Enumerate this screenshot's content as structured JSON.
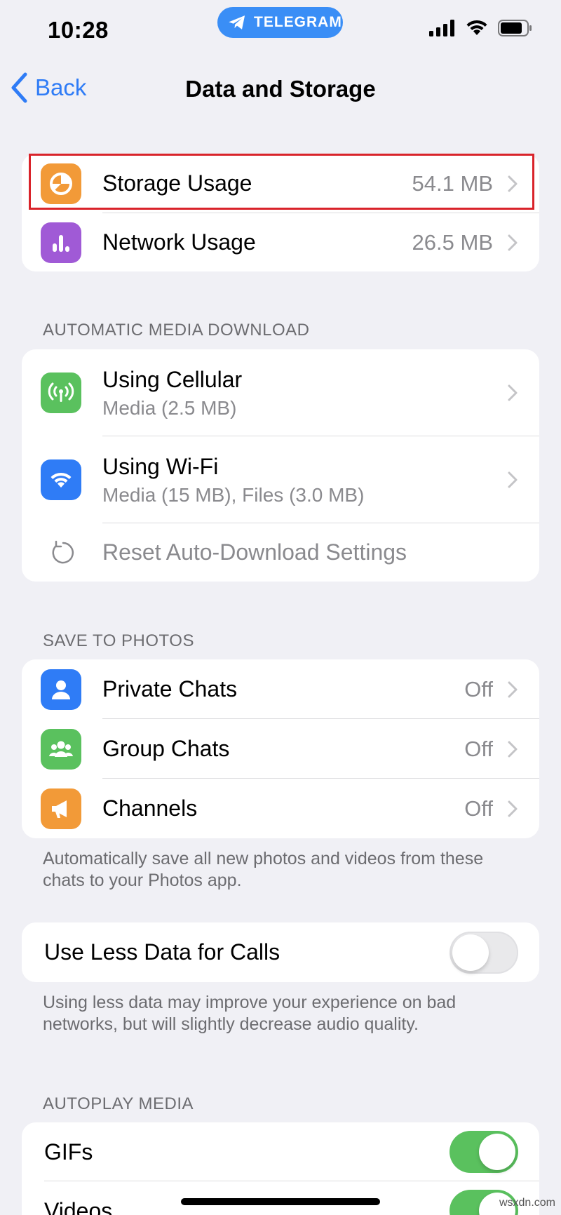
{
  "status_bar": {
    "time": "10:28",
    "pill_label": "TELEGRAM"
  },
  "nav": {
    "back_label": "Back",
    "title": "Data and Storage"
  },
  "usage": {
    "storage": {
      "label": "Storage Usage",
      "value": "54.1 MB",
      "icon": "pie-chart-icon",
      "color": "#f29a38"
    },
    "network": {
      "label": "Network Usage",
      "value": "26.5 MB",
      "icon": "bar-chart-icon",
      "color": "#a05ad6"
    }
  },
  "auto_download": {
    "header": "AUTOMATIC MEDIA DOWNLOAD",
    "cellular": {
      "label": "Using Cellular",
      "sub": "Media (2.5 MB)",
      "icon": "antenna-icon",
      "color": "#5ac15e"
    },
    "wifi": {
      "label": "Using Wi-Fi",
      "sub": "Media (15 MB), Files (3.0 MB)",
      "icon": "wifi-icon",
      "color": "#2f7cf6"
    },
    "reset": {
      "label": "Reset Auto-Download Settings",
      "icon": "reset-icon"
    }
  },
  "save_to_photos": {
    "header": "SAVE TO PHOTOS",
    "private": {
      "label": "Private Chats",
      "value": "Off",
      "icon": "person-icon",
      "color": "#2f7cf6"
    },
    "group": {
      "label": "Group Chats",
      "value": "Off",
      "icon": "group-icon",
      "color": "#5ac15e"
    },
    "channels": {
      "label": "Channels",
      "value": "Off",
      "icon": "megaphone-icon",
      "color": "#f29a38"
    },
    "footer": "Automatically save all new photos and videos from these chats to your Photos app."
  },
  "calls": {
    "label": "Use Less Data for Calls",
    "enabled": false,
    "footer": "Using less data may improve your experience on bad networks, but will slightly decrease audio quality."
  },
  "autoplay": {
    "header": "AUTOPLAY MEDIA",
    "gifs": {
      "label": "GIFs",
      "enabled": true
    },
    "videos": {
      "label": "Videos",
      "enabled": true
    }
  },
  "watermark": "wsxdn.com"
}
